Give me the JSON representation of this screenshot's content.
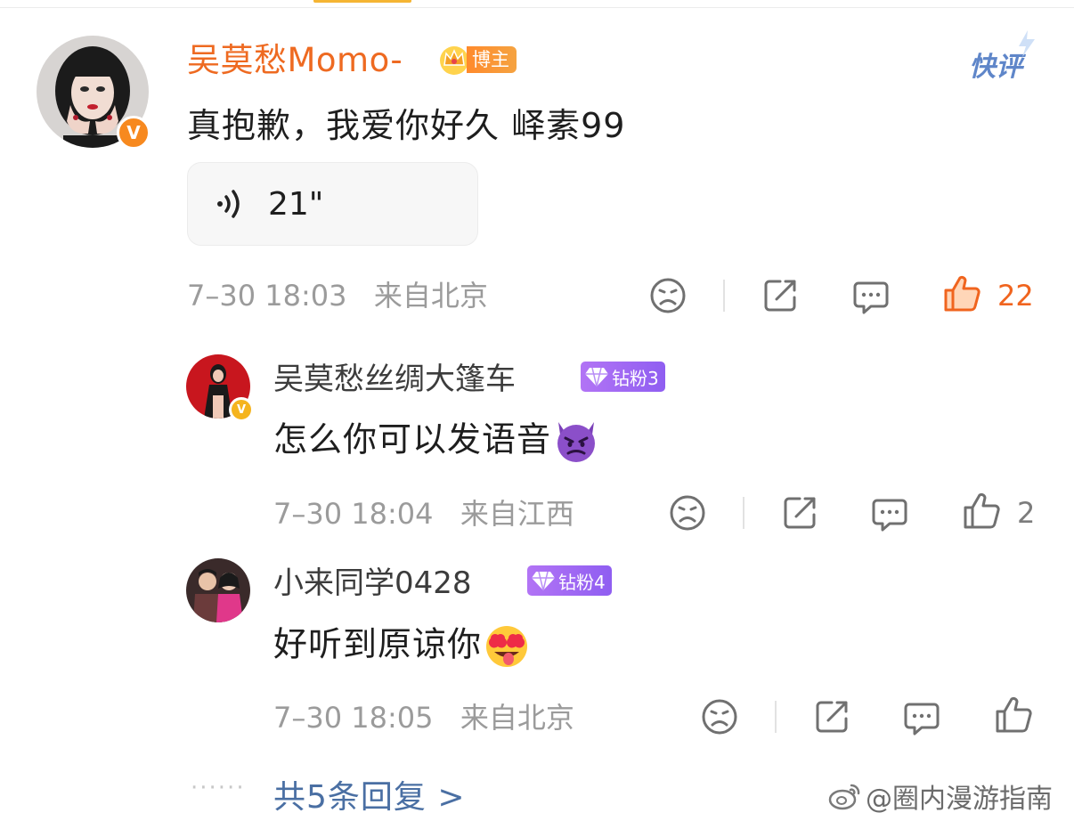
{
  "top_comment": {
    "username": "吴莫愁Momo-",
    "badge_label": "博主",
    "quick_review": "快评",
    "text": "真抱歉，我爱你好久 峄素99",
    "voice_duration": "21\"",
    "date": "7–30 18:03",
    "location": "来自北京",
    "like_count": "22"
  },
  "replies": [
    {
      "username": "吴莫愁丝绸大篷车",
      "badge_label": "钻粉3",
      "text": "怎么你可以发语音",
      "date": "7–30 18:04",
      "location": "来自江西",
      "like_count": "2"
    },
    {
      "username": "小来同学0428",
      "badge_label": "钻粉4",
      "text": "好听到原谅你",
      "date": "7–30 18:05",
      "location": "来自北京",
      "like_count": ""
    }
  ],
  "footer": {
    "dots": "······",
    "more_replies": "共5条回复 >",
    "watermark": "@圈内漫游指南"
  },
  "colors": {
    "username_orange": "#ee6a21",
    "like_active": "#f0641e",
    "link_blue": "#4a6fa3",
    "fan_badge_purple": "#9b66f3"
  },
  "icons": [
    "sad-face-icon",
    "share-icon",
    "comment-icon",
    "like-icon",
    "voice-wave-icon",
    "crown-icon",
    "diamond-icon",
    "weibo-logo-icon"
  ]
}
